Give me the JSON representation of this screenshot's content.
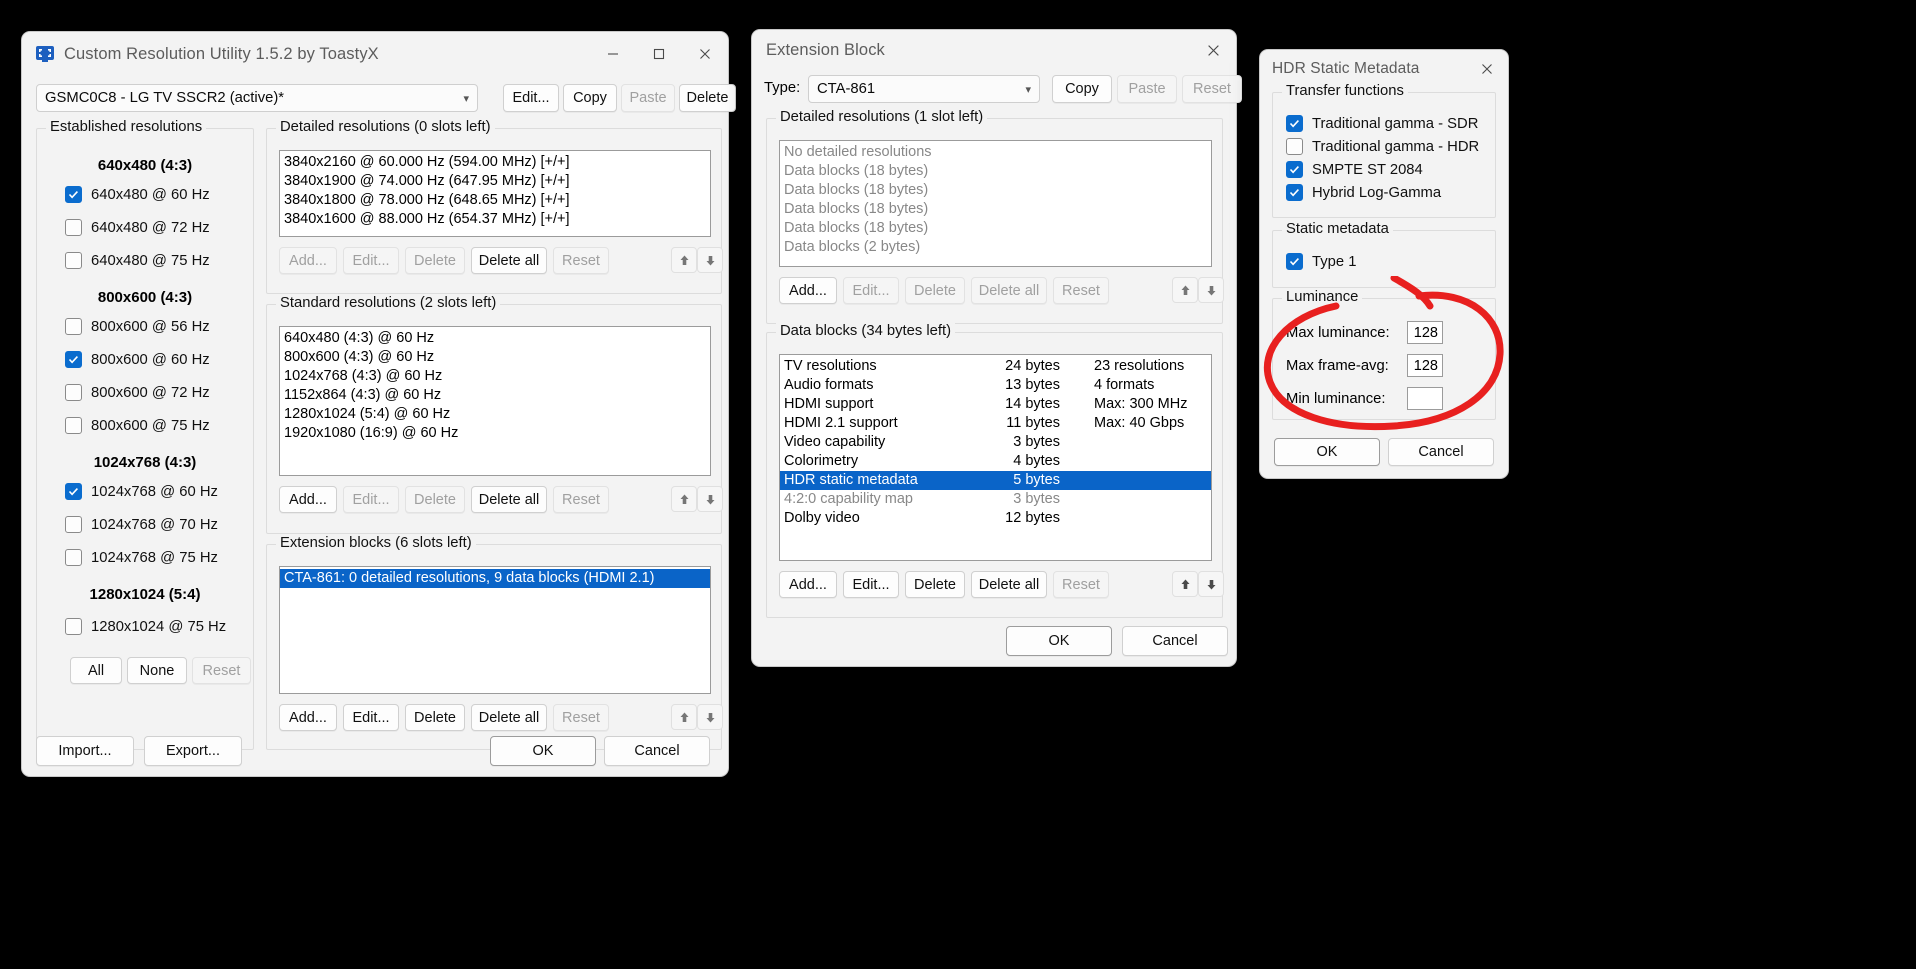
{
  "cru": {
    "title": "Custom Resolution Utility 1.5.2 by ToastyX",
    "icon": "monitor-icon",
    "caption": {
      "minimize": "minimize-icon",
      "maximize": "maximize-icon",
      "close": "close-icon"
    },
    "monitor_combo": {
      "value": "GSMC0C8 - LG TV SSCR2 (active)*",
      "chevron": "chevron-down-icon"
    },
    "top_buttons": [
      {
        "label": "Edit...",
        "disabled": false
      },
      {
        "label": "Copy",
        "disabled": false
      },
      {
        "label": "Paste",
        "disabled": true
      },
      {
        "label": "Delete",
        "disabled": false
      }
    ],
    "established": {
      "legend": "Established resolutions",
      "groups": [
        {
          "header": "640x480 (4:3)",
          "items": [
            {
              "label": "640x480 @ 60 Hz",
              "checked": true
            },
            {
              "label": "640x480 @ 72 Hz",
              "checked": false
            },
            {
              "label": "640x480 @ 75 Hz",
              "checked": false
            }
          ]
        },
        {
          "header": "800x600 (4:3)",
          "items": [
            {
              "label": "800x600 @ 56 Hz",
              "checked": false
            },
            {
              "label": "800x600 @ 60 Hz",
              "checked": true
            },
            {
              "label": "800x600 @ 72 Hz",
              "checked": false
            },
            {
              "label": "800x600 @ 75 Hz",
              "checked": false
            }
          ]
        },
        {
          "header": "1024x768 (4:3)",
          "items": [
            {
              "label": "1024x768 @ 60 Hz",
              "checked": true
            },
            {
              "label": "1024x768 @ 70 Hz",
              "checked": false
            },
            {
              "label": "1024x768 @ 75 Hz",
              "checked": false
            }
          ]
        },
        {
          "header": "1280x1024 (5:4)",
          "items": [
            {
              "label": "1280x1024 @ 75 Hz",
              "checked": false
            }
          ]
        }
      ],
      "buttons": [
        {
          "label": "All",
          "disabled": false
        },
        {
          "label": "None",
          "disabled": false
        },
        {
          "label": "Reset",
          "disabled": true
        }
      ]
    },
    "detailed": {
      "legend": "Detailed resolutions (0 slots left)",
      "items": [
        "3840x2160 @ 60.000 Hz (594.00 MHz) [+/+]",
        "3840x1900 @ 74.000 Hz (647.95 MHz) [+/+]",
        "3840x1800 @ 78.000 Hz (648.65 MHz) [+/+]",
        "3840x1600 @ 88.000 Hz (654.37 MHz) [+/+]"
      ],
      "buttons": [
        {
          "label": "Add...",
          "disabled": true
        },
        {
          "label": "Edit...",
          "disabled": true
        },
        {
          "label": "Delete",
          "disabled": true
        },
        {
          "label": "Delete all",
          "disabled": false
        },
        {
          "label": "Reset",
          "disabled": true
        }
      ],
      "move_up": "arrow-up-icon",
      "move_down": "arrow-down-icon"
    },
    "standard": {
      "legend": "Standard resolutions (2 slots left)",
      "items": [
        "640x480 (4:3) @ 60 Hz",
        "800x600 (4:3) @ 60 Hz",
        "1024x768 (4:3) @ 60 Hz",
        "1152x864 (4:3) @ 60 Hz",
        "1280x1024 (5:4) @ 60 Hz",
        "1920x1080 (16:9) @ 60 Hz"
      ],
      "buttons": [
        {
          "label": "Add...",
          "disabled": false
        },
        {
          "label": "Edit...",
          "disabled": true
        },
        {
          "label": "Delete",
          "disabled": true
        },
        {
          "label": "Delete all",
          "disabled": false
        },
        {
          "label": "Reset",
          "disabled": true
        }
      ],
      "move_up": "arrow-up-icon",
      "move_down": "arrow-down-icon"
    },
    "extension": {
      "legend": "Extension blocks (6 slots left)",
      "items": [
        {
          "label": "CTA-861: 0 detailed resolutions, 9 data blocks (HDMI 2.1)",
          "selected": true
        }
      ],
      "buttons": [
        {
          "label": "Add...",
          "disabled": false
        },
        {
          "label": "Edit...",
          "disabled": false
        },
        {
          "label": "Delete",
          "disabled": false
        },
        {
          "label": "Delete all",
          "disabled": false
        },
        {
          "label": "Reset",
          "disabled": true
        }
      ],
      "move_up": "arrow-up-icon",
      "move_down": "arrow-down-icon"
    },
    "footer": {
      "import": "Import...",
      "export": "Export...",
      "ok": "OK",
      "cancel": "Cancel"
    }
  },
  "extblock": {
    "title": "Extension Block",
    "close": "close-icon",
    "type_label": "Type:",
    "type_combo": {
      "value": "CTA-861",
      "chevron": "chevron-down-icon"
    },
    "top_buttons": [
      {
        "label": "Copy",
        "disabled": false
      },
      {
        "label": "Paste",
        "disabled": true
      },
      {
        "label": "Reset",
        "disabled": true
      }
    ],
    "detailed": {
      "legend": "Detailed resolutions (1 slot left)",
      "items": [
        "No detailed resolutions",
        "Data blocks (18 bytes)",
        "Data blocks (18 bytes)",
        "Data blocks (18 bytes)",
        "Data blocks (18 bytes)",
        "Data blocks (2 bytes)"
      ],
      "buttons": [
        {
          "label": "Add...",
          "disabled": false
        },
        {
          "label": "Edit...",
          "disabled": true
        },
        {
          "label": "Delete",
          "disabled": true
        },
        {
          "label": "Delete all",
          "disabled": true
        },
        {
          "label": "Reset",
          "disabled": true
        }
      ],
      "move_up": "arrow-up-icon",
      "move_down": "arrow-down-icon"
    },
    "datablocks": {
      "legend": "Data blocks (34 bytes left)",
      "rows": [
        {
          "name": "TV resolutions",
          "size": "24 bytes",
          "info": "23 resolutions",
          "selected": false,
          "gray": false
        },
        {
          "name": "Audio formats",
          "size": "13 bytes",
          "info": "4 formats",
          "selected": false,
          "gray": false
        },
        {
          "name": "HDMI support",
          "size": "14 bytes",
          "info": "Max: 300 MHz",
          "selected": false,
          "gray": false
        },
        {
          "name": "HDMI 2.1 support",
          "size": "11 bytes",
          "info": "Max: 40 Gbps",
          "selected": false,
          "gray": false
        },
        {
          "name": "Video capability",
          "size": "3 bytes",
          "info": "",
          "selected": false,
          "gray": false
        },
        {
          "name": "Colorimetry",
          "size": "4 bytes",
          "info": "",
          "selected": false,
          "gray": false
        },
        {
          "name": "HDR static metadata",
          "size": "5 bytes",
          "info": "",
          "selected": true,
          "gray": false
        },
        {
          "name": "4:2:0 capability map",
          "size": "3 bytes",
          "info": "",
          "selected": false,
          "gray": true
        },
        {
          "name": "Dolby video",
          "size": "12 bytes",
          "info": "",
          "selected": false,
          "gray": false
        }
      ],
      "buttons": [
        {
          "label": "Add...",
          "disabled": false
        },
        {
          "label": "Edit...",
          "disabled": false
        },
        {
          "label": "Delete",
          "disabled": false
        },
        {
          "label": "Delete all",
          "disabled": false
        },
        {
          "label": "Reset",
          "disabled": true
        }
      ],
      "move_up": "arrow-up-icon",
      "move_down": "arrow-down-icon"
    },
    "footer": {
      "ok": "OK",
      "cancel": "Cancel"
    }
  },
  "hdr": {
    "title": "HDR Static Metadata",
    "close": "close-icon",
    "transfer": {
      "legend": "Transfer functions",
      "items": [
        {
          "label": "Traditional gamma - SDR",
          "checked": true
        },
        {
          "label": "Traditional gamma - HDR",
          "checked": false
        },
        {
          "label": "SMPTE ST 2084",
          "checked": true
        },
        {
          "label": "Hybrid Log-Gamma",
          "checked": true
        }
      ]
    },
    "static": {
      "legend": "Static metadata",
      "items": [
        {
          "label": "Type 1",
          "checked": true
        }
      ]
    },
    "luminance": {
      "legend": "Luminance",
      "fields": [
        {
          "label": "Max luminance:",
          "value": "128"
        },
        {
          "label": "Max frame-avg:",
          "value": "128"
        },
        {
          "label": "Min luminance:",
          "value": ""
        }
      ]
    },
    "footer": {
      "ok": "OK",
      "cancel": "Cancel"
    }
  },
  "annotation": {
    "shape": "red-ellipse-highlight",
    "color": "#e8201f"
  }
}
